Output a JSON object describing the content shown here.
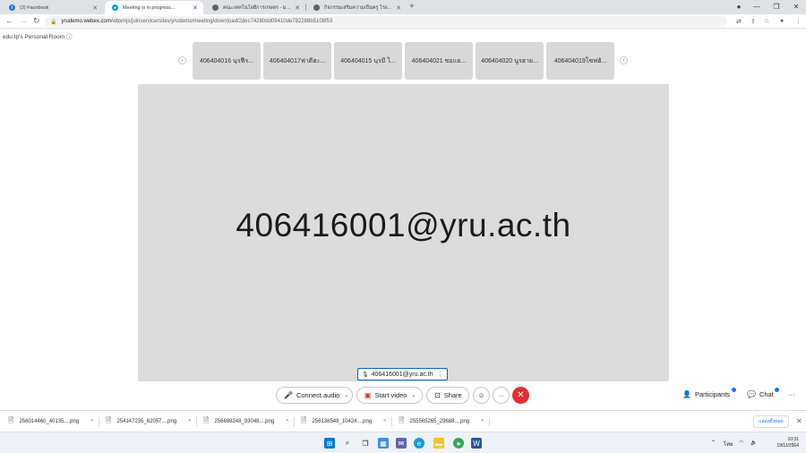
{
  "browser": {
    "tabs": [
      {
        "title": "(2) Facebook",
        "active": false,
        "favicon": "facebook-icon",
        "color": "#1877f2"
      },
      {
        "title": "Meeting is in progress...",
        "active": true,
        "favicon": "webex-icon",
        "color": "#00a0d1"
      },
      {
        "title": "คณะเทคโนโลยีการเกษตร - มหาวิทยาลัยราชภัฏยะลา",
        "active": false,
        "favicon": "globe-icon",
        "color": "#5f6368"
      },
      {
        "title": "กิจกรรมเสริมความเป็นครู โรงเรียน ...",
        "active": false,
        "favicon": "globe-icon",
        "color": "#5f6368"
      }
    ],
    "new_tab": "+",
    "address": {
      "host": "yrudemo.webex.com",
      "path": "/wbxmjs/joinservice/sites/yrudemo/meeting/download/2dec74280dd09410de782288b5108f53"
    }
  },
  "room": {
    "title": "edu tp's Personal Room",
    "info_icon": "info-icon"
  },
  "thumbnails": [
    {
      "label": "406404016 นุรฟีร..."
    },
    {
      "label": "406404017ฟาดีฮะ..."
    },
    {
      "label": "406404015 นุรมี ไ..."
    },
    {
      "label": "406404021 ซอเเย..."
    },
    {
      "label": "406404020 นูรฮาย..."
    },
    {
      "label": "406404019โซฟฮั..."
    }
  ],
  "stage": {
    "active_speaker": "406416001@yru.ac.th",
    "name_tag": "406416001@yru.ac.th"
  },
  "controls": {
    "connect_audio": "Connect audio",
    "start_video": "Start video",
    "share": "Share",
    "participants": "Participants",
    "chat": "Chat",
    "more": "···",
    "end": "✕"
  },
  "downloads": {
    "items": [
      {
        "name": "256014460_40135....png"
      },
      {
        "name": "254147235_62057....png"
      },
      {
        "name": "256698248_93048....png"
      },
      {
        "name": "256138549_10424....png"
      },
      {
        "name": "255565265_29688....png"
      }
    ],
    "show_all": "แสดงทั้งหมด",
    "close": "✕"
  },
  "taskbar": {
    "lang": "ไทย",
    "time": "10:31",
    "date": "19/11/2564"
  },
  "colors": {
    "stage_bg": "#dcdcdc",
    "accent": "#0b64c8",
    "end_call": "#e32c2c"
  }
}
